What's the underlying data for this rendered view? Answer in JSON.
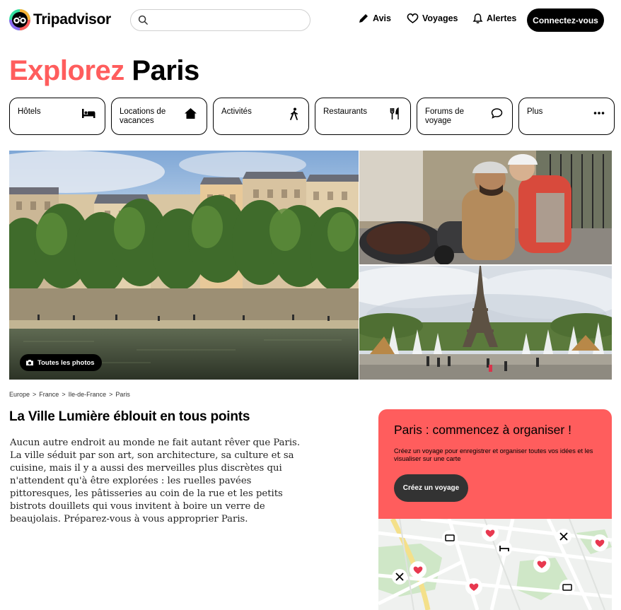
{
  "header": {
    "logo_text": "Tripadvisor",
    "search_placeholder": "",
    "nav": {
      "avis": "Avis",
      "voyages": "Voyages",
      "alertes": "Alertes"
    },
    "connect_label": "Connectez-vous"
  },
  "title": {
    "part1": "Explorez",
    "part2": "Paris",
    "accent_color": "#ff5d5d"
  },
  "tabs": [
    {
      "label": "Hôtels",
      "icon": "bed-icon"
    },
    {
      "label": "Locations de vacances",
      "icon": "house-icon"
    },
    {
      "label": "Activités",
      "icon": "walking-icon"
    },
    {
      "label": "Restaurants",
      "icon": "utensils-icon"
    },
    {
      "label": "Forums de voyage",
      "icon": "chat-bubble-icon"
    },
    {
      "label": "Plus",
      "icon": "more-icon"
    }
  ],
  "photos": {
    "all_photos_label": "Toutes les photos"
  },
  "breadcrumb": [
    "Europe",
    ">",
    "France",
    ">",
    "Ile-de-France",
    ">",
    "Paris"
  ],
  "section": {
    "title": "La Ville Lumière éblouit en tous points",
    "description": "Aucun autre endroit au monde ne fait autant rêver que Paris. La ville séduit par son art, son architecture, sa culture et sa cuisine, mais il y a aussi des merveilles plus discrètes qui n'attendent qu'à être explorées : les ruelles pavées pittoresques, les pâtisseries au coin de la rue et les petits bistrots douillets qui vous invitent à boire un verre de beaujolais. Préparez-vous à vous approprier Paris."
  },
  "plan_card": {
    "title": "Paris : commencez à organiser !",
    "description": "Créez un voyage pour enregistrer et organiser toutes vos idées et les visualiser sur une carte",
    "button_label": "Créez un voyage",
    "bg_color": "#ff5d5d"
  }
}
